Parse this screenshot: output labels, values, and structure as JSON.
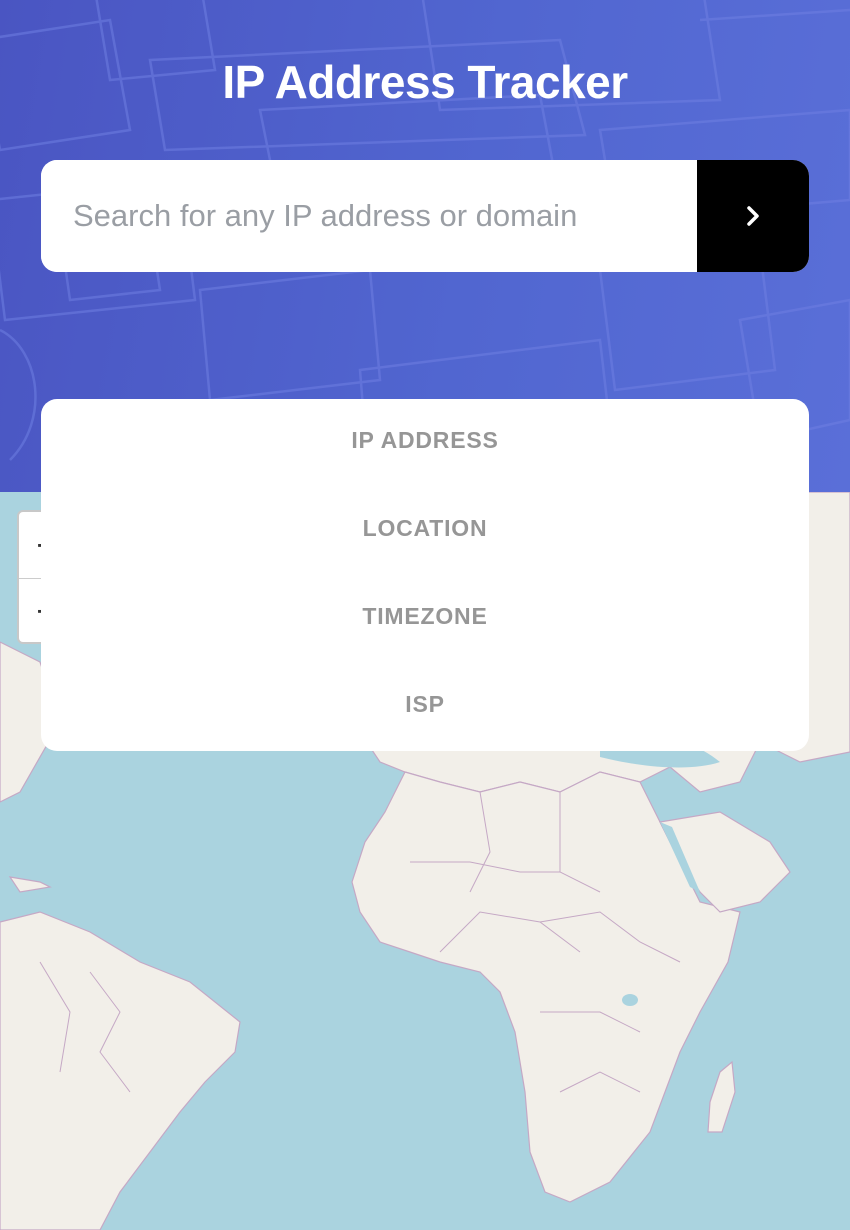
{
  "header": {
    "title": "IP Address Tracker",
    "background_color": "#5062cc"
  },
  "search": {
    "placeholder": "Search for any IP address or domain",
    "value": "",
    "submit_icon": "chevron-right-icon"
  },
  "info": {
    "labels": [
      "IP ADDRESS",
      "LOCATION",
      "TIMEZONE",
      "ISP"
    ]
  },
  "map": {
    "zoom_in_icon": "plus-icon",
    "zoom_out_icon": "minus-icon",
    "ocean_color": "#aad3df",
    "land_color": "#f2efe9",
    "border_color": "#b8a0c0"
  }
}
